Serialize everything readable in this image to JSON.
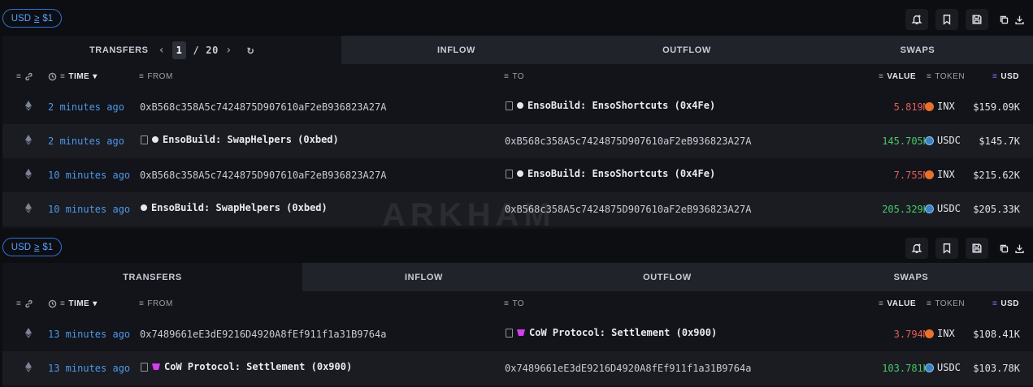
{
  "filter": {
    "label": "USD",
    "op": "≥",
    "amount": "$1"
  },
  "toolbar_icons": [
    "alert-bell-icon",
    "bookmark-icon",
    "save-icon",
    "copy-icon",
    "download-icon"
  ],
  "columns": {
    "time": "TIME",
    "from": "FROM",
    "to": "TO",
    "value": "VALUE",
    "token": "TOKEN",
    "usd": "USD"
  },
  "panel1": {
    "tabs": {
      "transfers": "TRANSFERS",
      "inflow": "INFLOW",
      "outflow": "OUTFLOW",
      "swaps": "SWAPS"
    },
    "pager": {
      "current": "1",
      "sep": "/",
      "total": "20"
    },
    "rows": [
      {
        "time": "2 minutes ago",
        "from": "0xB568c358A5c7424875D907610aF2eB936823A27A",
        "to": "EnsoBuild: EnsoShortcuts (0x4Fe)",
        "value": "5.819M",
        "token": "INX",
        "usd": "$159.09K"
      },
      {
        "time": "2 minutes ago",
        "from": "EnsoBuild: SwapHelpers (0xbed)",
        "to": "0xB568c358A5c7424875D907610aF2eB936823A27A",
        "value": "145.705K",
        "token": "USDC",
        "usd": "$145.7K"
      },
      {
        "time": "10 minutes ago",
        "from": "0xB568c358A5c7424875D907610aF2eB936823A27A",
        "to": "EnsoBuild: EnsoShortcuts (0x4Fe)",
        "value": "7.755M",
        "token": "INX",
        "usd": "$215.62K"
      },
      {
        "time": "10 minutes ago",
        "from": "EnsoBuild: SwapHelpers (0xbed)",
        "to": "0xB568c358A5c7424875D907610aF2eB936823A27A",
        "value": "205.329K",
        "token": "USDC",
        "usd": "$205.33K"
      }
    ]
  },
  "panel2": {
    "tabs": {
      "transfers": "TRANSFERS",
      "inflow": "INFLOW",
      "outflow": "OUTFLOW",
      "swaps": "SWAPS"
    },
    "rows": [
      {
        "time": "13 minutes ago",
        "from": "0x7489661eE3dE9216D4920A8fEf911f1a31B9764a",
        "to": "CoW Protocol: Settlement (0x900)",
        "value": "3.794M",
        "token": "INX",
        "usd": "$108.41K"
      },
      {
        "time": "13 minutes ago",
        "from": "CoW Protocol: Settlement (0x900)",
        "to": "0x7489661eE3dE9216D4920A8fEf911f1a31B9764a",
        "value": "103.781K",
        "token": "USDC",
        "usd": "$103.78K"
      }
    ]
  },
  "watermark": "ARKHAM",
  "colors": {
    "accent": "#4e96ea",
    "out": "#e35d5d",
    "in": "#49c86b"
  }
}
